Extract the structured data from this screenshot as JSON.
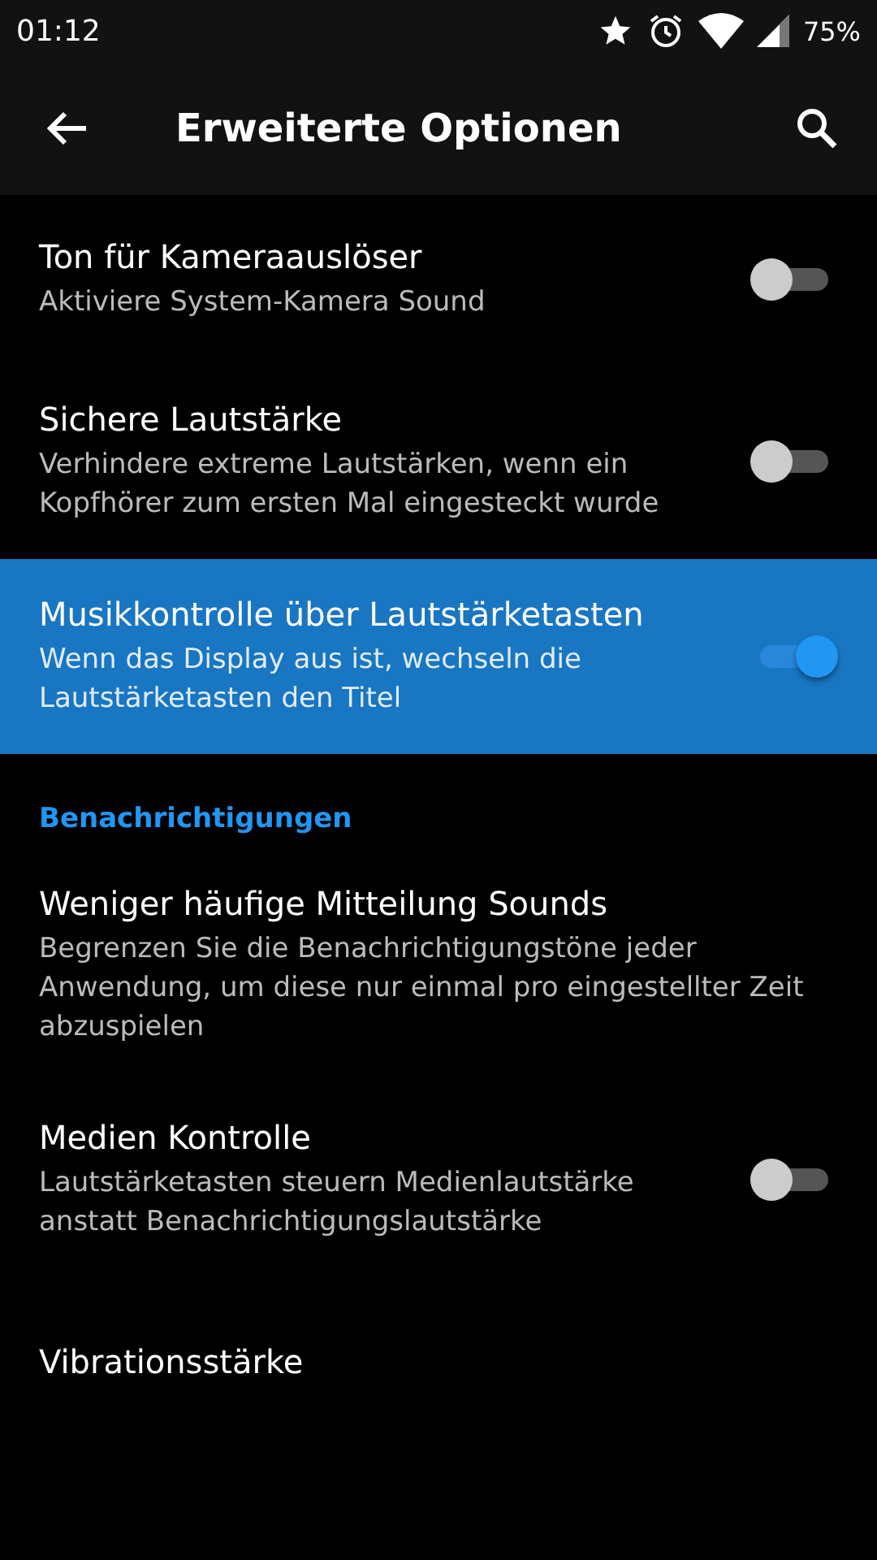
{
  "status_bar": {
    "time": "01:12",
    "battery": "75%"
  },
  "toolbar": {
    "title": "Erweiterte Optionen"
  },
  "items": [
    {
      "kind": "toggle",
      "title": "Ton für Kameraauslöser",
      "summary": "Aktiviere System-Kamera Sound",
      "on": false,
      "selected": false
    },
    {
      "kind": "toggle",
      "title": "Sichere Lautstärke",
      "summary": "Verhindere extreme Lautstärken, wenn ein Kopfhörer zum ersten Mal eingesteckt wurde",
      "on": false,
      "selected": false
    },
    {
      "kind": "toggle",
      "title": "Musikkontrolle über Lautstärketasten",
      "summary": "Wenn das Display aus ist, wechseln die Lautstärketasten den Titel",
      "on": true,
      "selected": true
    },
    {
      "kind": "header",
      "title": "Benachrichtigungen"
    },
    {
      "kind": "plain",
      "title": "Weniger häufige Mitteilung Sounds",
      "summary": "Begrenzen Sie die Benachrichtigungstöne jeder Anwendung, um diese nur einmal pro eingestellter Zeit abzuspielen",
      "selected": false
    },
    {
      "kind": "toggle",
      "title": "Medien Kontrolle",
      "summary": "Lautstärketasten steuern Medienlautstärke anstatt Benachrichtigungslautstärke",
      "on": false,
      "selected": false
    },
    {
      "kind": "plain",
      "title": "Vibrationsstärke",
      "selected": false
    }
  ]
}
